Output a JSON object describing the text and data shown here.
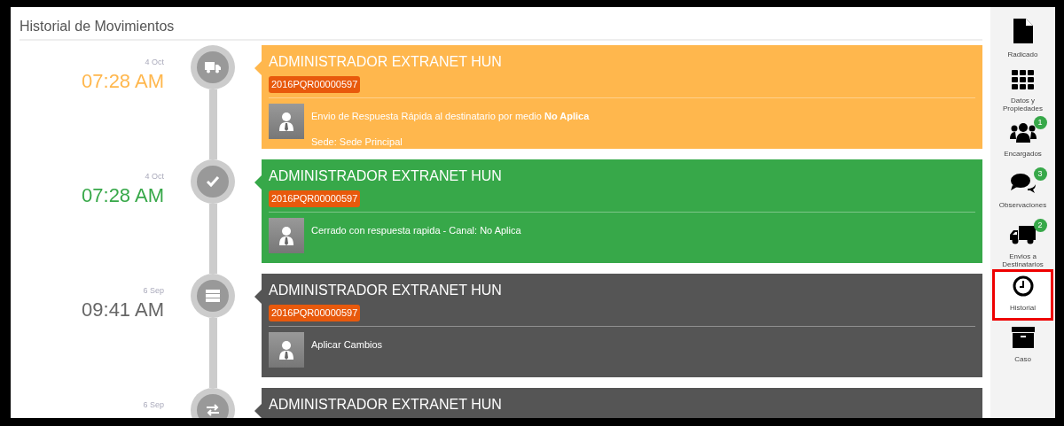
{
  "panel": {
    "title": "Historial de Movimientos"
  },
  "entries": [
    {
      "kind": "shipment",
      "color": "#ffb74d",
      "date": "4 Oct",
      "time": "07:28 AM",
      "author": "ADMINISTRADOR EXTRANET HUN",
      "reference": "2016PQR00000597",
      "lines": [
        "Envio de Respuesta Rápida al destinatario por medio **No Aplica**",
        "Sede: Sede Principal"
      ]
    },
    {
      "kind": "closed",
      "color": "#37a849",
      "date": "4 Oct",
      "time": "07:28 AM",
      "author": "ADMINISTRADOR EXTRANET HUN",
      "reference": "2016PQR00000597",
      "lines": [
        "Cerrado con respuesta rapida - Canal: No Aplica"
      ]
    },
    {
      "kind": "changes",
      "color": "#555555",
      "date": "6 Sep",
      "time": "09:41 AM",
      "author": "ADMINISTRADOR EXTRANET HUN",
      "reference": "2016PQR00000597",
      "lines": [
        "Aplicar Cambios"
      ]
    },
    {
      "kind": "transfer",
      "color": "#555555",
      "date": "6 Sep",
      "author": "ADMINISTRADOR EXTRANET HUN"
    }
  ],
  "sidebar": {
    "items": [
      {
        "kind": "file",
        "label": "Radicado",
        "selected": false
      },
      {
        "kind": "grid",
        "label": "Datos y Propiedades",
        "selected": false
      },
      {
        "kind": "users",
        "label": "Encargados",
        "count": "1",
        "selected": false
      },
      {
        "kind": "comments",
        "label": "Observaciones",
        "count": "3",
        "selected": false
      },
      {
        "kind": "truck",
        "label": "Envios a Destinatarios",
        "count": "2",
        "selected": false
      },
      {
        "kind": "clock",
        "label": "Historial",
        "selected": true
      },
      {
        "kind": "archive",
        "label": "Caso",
        "selected": false
      }
    ]
  }
}
